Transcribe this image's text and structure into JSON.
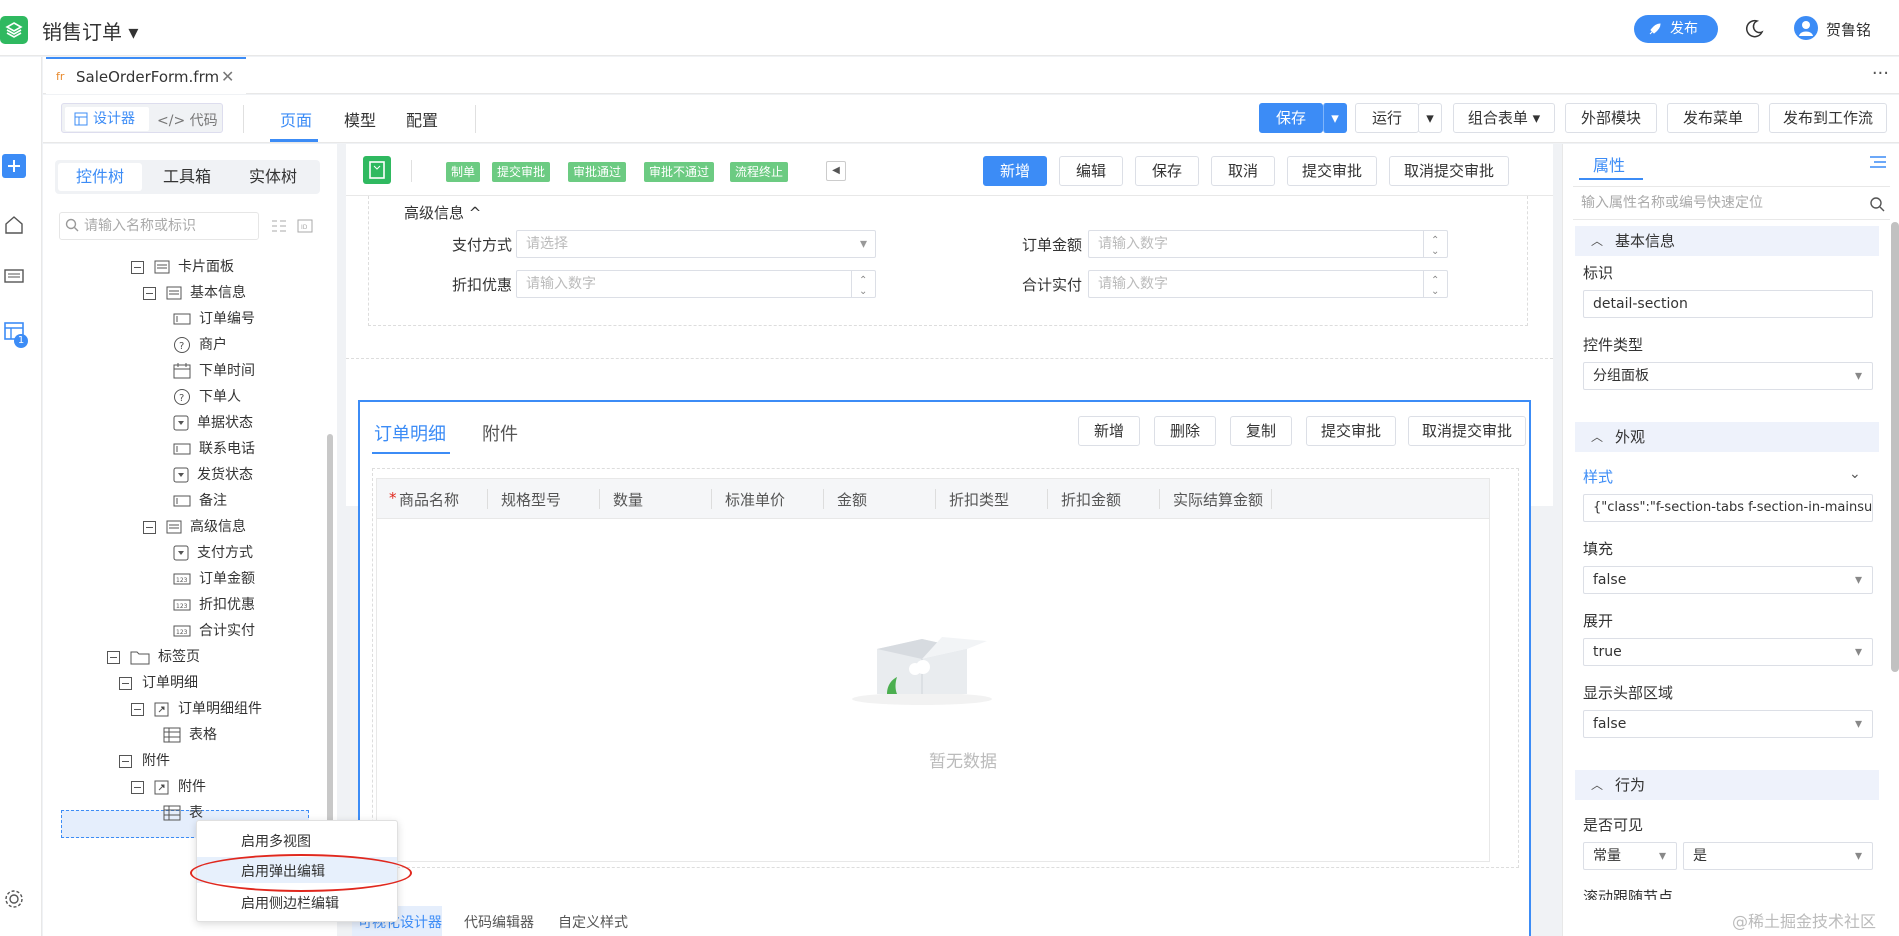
{
  "app": {
    "title": "销售订单 ▾",
    "publish": "发布",
    "user": "贺鲁铭"
  },
  "file_tab": {
    "icon": "fr",
    "name": "SaleOrderForm.frm",
    "close": "✕",
    "more": "···"
  },
  "toolbar": {
    "designer": "设计器",
    "code": "</> 代码",
    "tabs": [
      "页面",
      "模型",
      "配置"
    ],
    "save": "保存",
    "run": "运行",
    "combo": "组合表单 ▾",
    "external": "外部模块",
    "publish_menu": "发布菜单",
    "publish_workflow": "发布到工作流"
  },
  "tree": {
    "tabs": [
      "控件树",
      "工具箱",
      "实体树"
    ],
    "search_placeholder": "请输入名称或标识",
    "items": [
      {
        "label": "卡片面板",
        "icon": "card-icon"
      },
      {
        "label": "基本信息",
        "icon": "card-icon"
      },
      {
        "label": "订单编号",
        "icon": "input-icon"
      },
      {
        "label": "商户",
        "icon": "help-icon"
      },
      {
        "label": "下单时间",
        "icon": "calendar-icon"
      },
      {
        "label": "下单人",
        "icon": "help-icon"
      },
      {
        "label": "单据状态",
        "icon": "dropdown-icon"
      },
      {
        "label": "联系电话",
        "icon": "input-icon"
      },
      {
        "label": "发货状态",
        "icon": "dropdown-icon"
      },
      {
        "label": "备注",
        "icon": "input-icon"
      },
      {
        "label": "高级信息",
        "icon": "card-icon"
      },
      {
        "label": "支付方式",
        "icon": "dropdown-icon"
      },
      {
        "label": "订单金额",
        "icon": "number-icon"
      },
      {
        "label": "折扣优惠",
        "icon": "number-icon"
      },
      {
        "label": "合计实付",
        "icon": "number-icon"
      },
      {
        "label": "标签页",
        "icon": "folder-icon"
      },
      {
        "label": "订单明细",
        "icon": "none"
      },
      {
        "label": "订单明细组件",
        "icon": "component-icon"
      },
      {
        "label": "表格",
        "icon": "table-icon"
      },
      {
        "label": "附件",
        "icon": "none"
      },
      {
        "label": "附件",
        "icon": "component-icon"
      },
      {
        "label": "表",
        "icon": "table-icon"
      }
    ]
  },
  "context_menu": [
    "启用多视图",
    "启用弹出编辑",
    "启用侧边栏编辑"
  ],
  "canvas": {
    "status_chips": [
      "制单",
      "提交审批",
      "审批通过",
      "审批不通过",
      "流程终止"
    ],
    "buttons": [
      "新增",
      "编辑",
      "保存",
      "取消",
      "提交审批",
      "取消提交审批"
    ],
    "advanced": {
      "header": "高级信息 ^",
      "fields": [
        {
          "label": "支付方式",
          "placeholder": "请选择"
        },
        {
          "label": "订单金额",
          "placeholder": "请输入数字"
        },
        {
          "label": "折扣优惠",
          "placeholder": "请输入数字"
        },
        {
          "label": "合计实付",
          "placeholder": "请输入数字"
        }
      ]
    },
    "detail": {
      "tabs": [
        "订单明细",
        "附件"
      ],
      "buttons": [
        "新增",
        "删除",
        "复制",
        "提交审批",
        "取消提交审批"
      ],
      "columns": [
        "商品名称",
        "规格型号",
        "数量",
        "标准单价",
        "金额",
        "折扣类型",
        "折扣金额",
        "实际结算金额"
      ],
      "required_mark": "*",
      "empty": "暂无数据"
    },
    "bottom_tabs": [
      "可视化设计器",
      "代码编辑器",
      "自定义样式"
    ]
  },
  "props": {
    "tab": "属性",
    "search_placeholder": "输入属性名称或编号快速定位",
    "sections": {
      "basic": "基本信息",
      "appearance": "外观",
      "behavior": "行为"
    },
    "id_label": "标识",
    "id_value": "detail-section",
    "type_label": "控件类型",
    "type_value": "分组面板",
    "style_label": "样式",
    "style_value": "{\"class\":\"f-section-tabs f-section-in-mainsubcard\"}",
    "fill_label": "填充",
    "fill_value": "false",
    "expand_label": "展开",
    "expand_value": "true",
    "header_label": "显示头部区域",
    "header_value": "false",
    "visible_label": "是否可见",
    "visible_mode": "常量",
    "visible_value": "是",
    "scroll_label": "滚动跟随节点"
  },
  "rail_badge": "1",
  "watermark": "@稀土掘金技术社区",
  "colors": {
    "primary": "#3c8cf6",
    "green": "#2fb960",
    "chip": "#6ccb82",
    "highlight": "#e0281e"
  }
}
